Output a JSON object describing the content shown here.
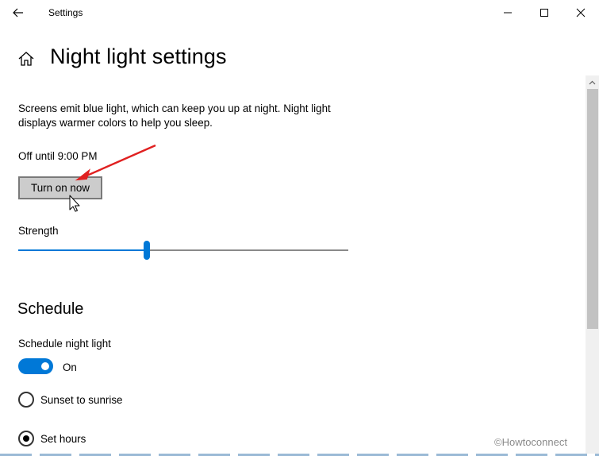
{
  "window": {
    "title": "Settings",
    "controls": [
      "minimize",
      "maximize",
      "close"
    ]
  },
  "header": {
    "title": "Night light settings",
    "home_icon": "home-icon"
  },
  "main": {
    "description": "Screens emit blue light, which can keep you up at night. Night light displays warmer colors to help you sleep.",
    "status": "Off until 9:00 PM",
    "turn_on_button": "Turn on now",
    "strength": {
      "label": "Strength",
      "value_fraction": 0.39
    },
    "schedule": {
      "heading": "Schedule",
      "toggle_label": "Schedule night light",
      "toggle_state": "On",
      "options": [
        {
          "label": "Sunset to sunrise",
          "selected": false
        },
        {
          "label": "Set hours",
          "selected": true
        }
      ]
    }
  },
  "watermark": "©Howtoconnect",
  "colors": {
    "accent": "#0078d7",
    "button_bg": "#cccccc",
    "annotation_arrow": "#e02020"
  }
}
